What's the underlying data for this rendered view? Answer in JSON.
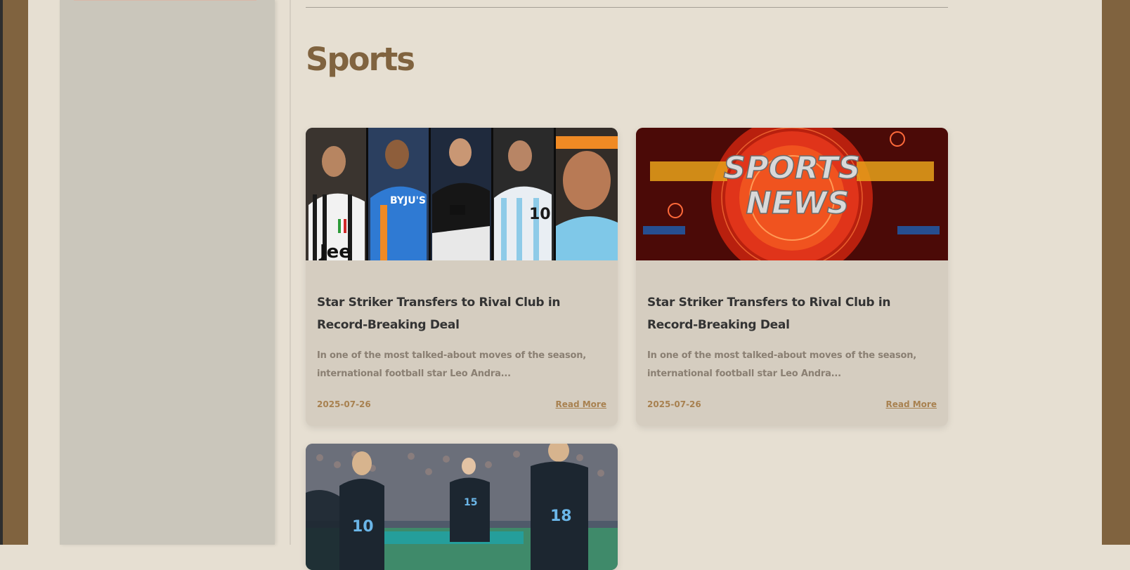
{
  "page": {
    "title": "Sports"
  },
  "articles": [
    {
      "title": "Star Striker Transfers to Rival Club in Record-Breaking Deal",
      "excerpt": "In one of the most talked-about moves of the season, international football star Leo Andra...",
      "date": "2025-07-26",
      "link_label": "Read More",
      "image_icon": "sports-stars-collage-image"
    },
    {
      "title": "Star Striker Transfers to Rival Club in Record-Breaking Deal",
      "excerpt": "In one of the most talked-about moves of the season, international football star Leo Andra...",
      "date": "2025-07-26",
      "link_label": "Read More",
      "image_icon": "sports-news-banner-image",
      "image_text": {
        "line1": "SPORTS",
        "line2": "NEWS"
      }
    },
    {
      "image_icon": "football-team-celebration-image",
      "jersey_numbers": [
        "10",
        "15",
        "18"
      ]
    }
  ],
  "colors": {
    "accent_brown": "#80633f",
    "background": "#e6dfd2",
    "card": "#d5cdc0",
    "link": "#a88150"
  }
}
